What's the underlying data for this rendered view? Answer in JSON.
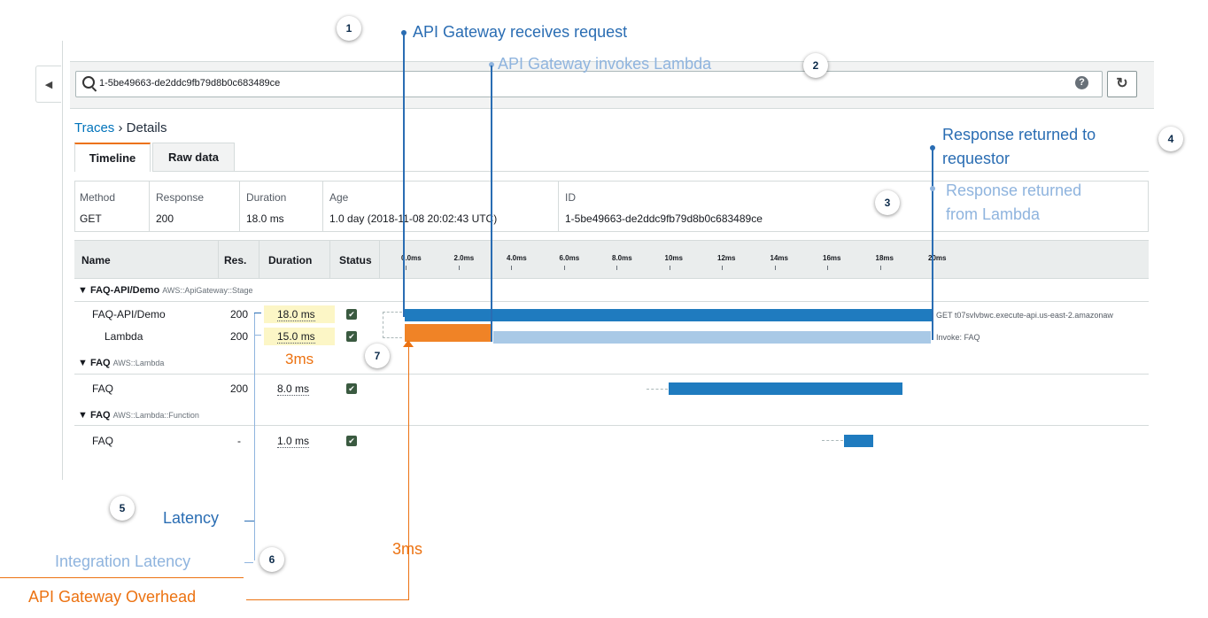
{
  "search": {
    "value": "1-5be49663-de2ddc9fb79d8b0c683489ce",
    "help_icon": "?",
    "refresh_icon": "↻",
    "collapse_icon": "◀"
  },
  "breadcrumb": {
    "link": "Traces",
    "separator": " › ",
    "current": "Details"
  },
  "tabs": [
    {
      "label": "Timeline"
    },
    {
      "label": "Raw data"
    }
  ],
  "summary": {
    "headers": {
      "method": "Method",
      "response": "Response",
      "duration": "Duration",
      "age": "Age",
      "id": "ID"
    },
    "values": {
      "method": "GET",
      "response": "200",
      "duration": "18.0 ms",
      "age": "1.0 day (2018-11-08 20:02:43 UTC)",
      "id": "1-5be49663-de2ddc9fb79d8b0c683489ce"
    }
  },
  "table": {
    "headers": {
      "name": "Name",
      "res": "Res.",
      "duration": "Duration",
      "status": "Status"
    },
    "ticks": [
      "0.0ms",
      "2.0ms",
      "4.0ms",
      "6.0ms",
      "8.0ms",
      "10ms",
      "12ms",
      "14ms",
      "16ms",
      "18ms",
      "20ms"
    ],
    "groups": [
      {
        "title": "FAQ-API/Demo",
        "sub": "AWS::ApiGateway::Stage",
        "toggle": "▼"
      },
      {
        "title": "FAQ",
        "sub": "AWS::Lambda",
        "toggle": "▼"
      },
      {
        "title": "FAQ",
        "sub": "AWS::Lambda::Function",
        "toggle": "▼"
      }
    ],
    "rows": [
      {
        "name": "FAQ-API/Demo",
        "res": "200",
        "duration": "18.0 ms",
        "status": "✔",
        "label": "GET t07svlvbwc.execute-api.us-east-2.amazonaw"
      },
      {
        "name": "Lambda",
        "res": "200",
        "duration": "15.0 ms",
        "status": "✔",
        "label": "Invoke: FAQ"
      },
      {
        "name": "FAQ",
        "res": "200",
        "duration": "8.0 ms",
        "status": "✔",
        "label": ""
      },
      {
        "name": "FAQ",
        "res": "-",
        "duration": "1.0 ms",
        "status": "✔",
        "label": ""
      }
    ]
  },
  "annotations": {
    "n1": "1",
    "n2": "2",
    "n3": "3",
    "n4": "4",
    "n5": "5",
    "n6": "6",
    "n7": "7",
    "gw_receives": "API Gateway receives request",
    "gw_invokes": "API Gateway invokes Lambda",
    "resp_requestor_1": "Response returned to",
    "resp_requestor_2": "requestor",
    "resp_lambda_1": "Response returned",
    "resp_lambda_2": "from Lambda",
    "latency": "Latency",
    "integration_latency": "Integration Latency",
    "gw_overhead": "API Gateway Overhead",
    "three_ms_small": "3ms",
    "three_ms_big": "3ms"
  },
  "colors": {
    "dark_blue": "#1f7bbf",
    "light_blue": "#a9c9e6",
    "orange": "#f08326",
    "link": "#0073bb"
  }
}
